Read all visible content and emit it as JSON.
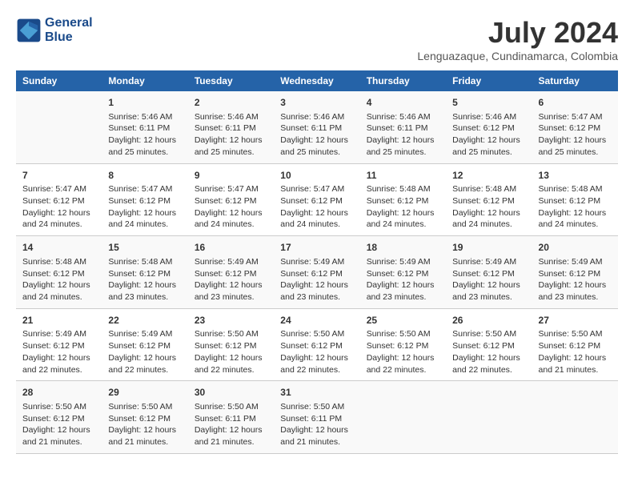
{
  "header": {
    "logo_line1": "General",
    "logo_line2": "Blue",
    "month_year": "July 2024",
    "location": "Lenguazaque, Cundinamarca, Colombia"
  },
  "days_of_week": [
    "Sunday",
    "Monday",
    "Tuesday",
    "Wednesday",
    "Thursday",
    "Friday",
    "Saturday"
  ],
  "weeks": [
    [
      {
        "day": "",
        "info": ""
      },
      {
        "day": "1",
        "sunrise": "Sunrise: 5:46 AM",
        "sunset": "Sunset: 6:11 PM",
        "daylight": "Daylight: 12 hours and 25 minutes."
      },
      {
        "day": "2",
        "sunrise": "Sunrise: 5:46 AM",
        "sunset": "Sunset: 6:11 PM",
        "daylight": "Daylight: 12 hours and 25 minutes."
      },
      {
        "day": "3",
        "sunrise": "Sunrise: 5:46 AM",
        "sunset": "Sunset: 6:11 PM",
        "daylight": "Daylight: 12 hours and 25 minutes."
      },
      {
        "day": "4",
        "sunrise": "Sunrise: 5:46 AM",
        "sunset": "Sunset: 6:11 PM",
        "daylight": "Daylight: 12 hours and 25 minutes."
      },
      {
        "day": "5",
        "sunrise": "Sunrise: 5:46 AM",
        "sunset": "Sunset: 6:12 PM",
        "daylight": "Daylight: 12 hours and 25 minutes."
      },
      {
        "day": "6",
        "sunrise": "Sunrise: 5:47 AM",
        "sunset": "Sunset: 6:12 PM",
        "daylight": "Daylight: 12 hours and 25 minutes."
      }
    ],
    [
      {
        "day": "7",
        "sunrise": "Sunrise: 5:47 AM",
        "sunset": "Sunset: 6:12 PM",
        "daylight": "Daylight: 12 hours and 24 minutes."
      },
      {
        "day": "8",
        "sunrise": "Sunrise: 5:47 AM",
        "sunset": "Sunset: 6:12 PM",
        "daylight": "Daylight: 12 hours and 24 minutes."
      },
      {
        "day": "9",
        "sunrise": "Sunrise: 5:47 AM",
        "sunset": "Sunset: 6:12 PM",
        "daylight": "Daylight: 12 hours and 24 minutes."
      },
      {
        "day": "10",
        "sunrise": "Sunrise: 5:47 AM",
        "sunset": "Sunset: 6:12 PM",
        "daylight": "Daylight: 12 hours and 24 minutes."
      },
      {
        "day": "11",
        "sunrise": "Sunrise: 5:48 AM",
        "sunset": "Sunset: 6:12 PM",
        "daylight": "Daylight: 12 hours and 24 minutes."
      },
      {
        "day": "12",
        "sunrise": "Sunrise: 5:48 AM",
        "sunset": "Sunset: 6:12 PM",
        "daylight": "Daylight: 12 hours and 24 minutes."
      },
      {
        "day": "13",
        "sunrise": "Sunrise: 5:48 AM",
        "sunset": "Sunset: 6:12 PM",
        "daylight": "Daylight: 12 hours and 24 minutes."
      }
    ],
    [
      {
        "day": "14",
        "sunrise": "Sunrise: 5:48 AM",
        "sunset": "Sunset: 6:12 PM",
        "daylight": "Daylight: 12 hours and 24 minutes."
      },
      {
        "day": "15",
        "sunrise": "Sunrise: 5:48 AM",
        "sunset": "Sunset: 6:12 PM",
        "daylight": "Daylight: 12 hours and 23 minutes."
      },
      {
        "day": "16",
        "sunrise": "Sunrise: 5:49 AM",
        "sunset": "Sunset: 6:12 PM",
        "daylight": "Daylight: 12 hours and 23 minutes."
      },
      {
        "day": "17",
        "sunrise": "Sunrise: 5:49 AM",
        "sunset": "Sunset: 6:12 PM",
        "daylight": "Daylight: 12 hours and 23 minutes."
      },
      {
        "day": "18",
        "sunrise": "Sunrise: 5:49 AM",
        "sunset": "Sunset: 6:12 PM",
        "daylight": "Daylight: 12 hours and 23 minutes."
      },
      {
        "day": "19",
        "sunrise": "Sunrise: 5:49 AM",
        "sunset": "Sunset: 6:12 PM",
        "daylight": "Daylight: 12 hours and 23 minutes."
      },
      {
        "day": "20",
        "sunrise": "Sunrise: 5:49 AM",
        "sunset": "Sunset: 6:12 PM",
        "daylight": "Daylight: 12 hours and 23 minutes."
      }
    ],
    [
      {
        "day": "21",
        "sunrise": "Sunrise: 5:49 AM",
        "sunset": "Sunset: 6:12 PM",
        "daylight": "Daylight: 12 hours and 22 minutes."
      },
      {
        "day": "22",
        "sunrise": "Sunrise: 5:49 AM",
        "sunset": "Sunset: 6:12 PM",
        "daylight": "Daylight: 12 hours and 22 minutes."
      },
      {
        "day": "23",
        "sunrise": "Sunrise: 5:50 AM",
        "sunset": "Sunset: 6:12 PM",
        "daylight": "Daylight: 12 hours and 22 minutes."
      },
      {
        "day": "24",
        "sunrise": "Sunrise: 5:50 AM",
        "sunset": "Sunset: 6:12 PM",
        "daylight": "Daylight: 12 hours and 22 minutes."
      },
      {
        "day": "25",
        "sunrise": "Sunrise: 5:50 AM",
        "sunset": "Sunset: 6:12 PM",
        "daylight": "Daylight: 12 hours and 22 minutes."
      },
      {
        "day": "26",
        "sunrise": "Sunrise: 5:50 AM",
        "sunset": "Sunset: 6:12 PM",
        "daylight": "Daylight: 12 hours and 22 minutes."
      },
      {
        "day": "27",
        "sunrise": "Sunrise: 5:50 AM",
        "sunset": "Sunset: 6:12 PM",
        "daylight": "Daylight: 12 hours and 21 minutes."
      }
    ],
    [
      {
        "day": "28",
        "sunrise": "Sunrise: 5:50 AM",
        "sunset": "Sunset: 6:12 PM",
        "daylight": "Daylight: 12 hours and 21 minutes."
      },
      {
        "day": "29",
        "sunrise": "Sunrise: 5:50 AM",
        "sunset": "Sunset: 6:12 PM",
        "daylight": "Daylight: 12 hours and 21 minutes."
      },
      {
        "day": "30",
        "sunrise": "Sunrise: 5:50 AM",
        "sunset": "Sunset: 6:11 PM",
        "daylight": "Daylight: 12 hours and 21 minutes."
      },
      {
        "day": "31",
        "sunrise": "Sunrise: 5:50 AM",
        "sunset": "Sunset: 6:11 PM",
        "daylight": "Daylight: 12 hours and 21 minutes."
      },
      {
        "day": "",
        "info": ""
      },
      {
        "day": "",
        "info": ""
      },
      {
        "day": "",
        "info": ""
      }
    ]
  ]
}
